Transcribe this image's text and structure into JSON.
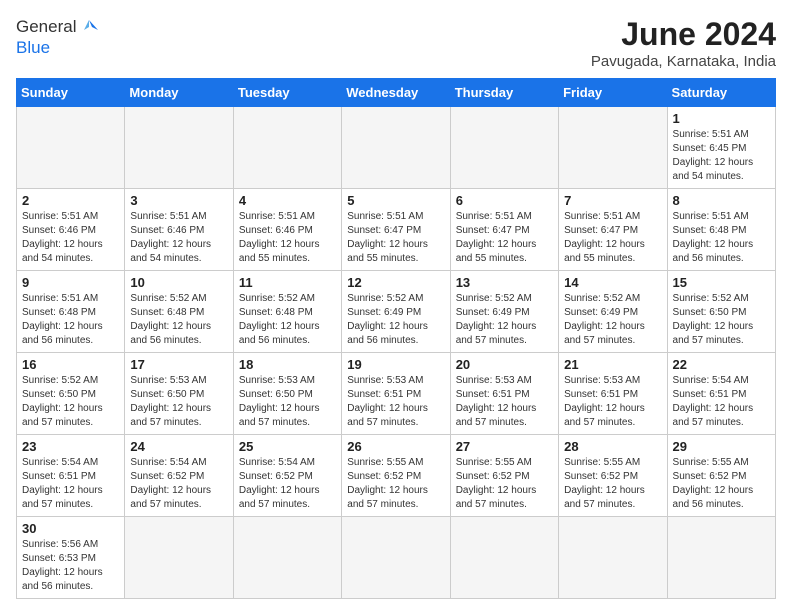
{
  "header": {
    "logo_general": "General",
    "logo_blue": "Blue",
    "month_title": "June 2024",
    "subtitle": "Pavugada, Karnataka, India"
  },
  "weekdays": [
    "Sunday",
    "Monday",
    "Tuesday",
    "Wednesday",
    "Thursday",
    "Friday",
    "Saturday"
  ],
  "weeks": [
    [
      {
        "day": "",
        "content": ""
      },
      {
        "day": "",
        "content": ""
      },
      {
        "day": "",
        "content": ""
      },
      {
        "day": "",
        "content": ""
      },
      {
        "day": "",
        "content": ""
      },
      {
        "day": "",
        "content": ""
      },
      {
        "day": "1",
        "content": "Sunrise: 5:51 AM\nSunset: 6:45 PM\nDaylight: 12 hours and 54 minutes."
      }
    ],
    [
      {
        "day": "2",
        "content": "Sunrise: 5:51 AM\nSunset: 6:46 PM\nDaylight: 12 hours and 54 minutes."
      },
      {
        "day": "3",
        "content": "Sunrise: 5:51 AM\nSunset: 6:46 PM\nDaylight: 12 hours and 54 minutes."
      },
      {
        "day": "4",
        "content": "Sunrise: 5:51 AM\nSunset: 6:46 PM\nDaylight: 12 hours and 55 minutes."
      },
      {
        "day": "5",
        "content": "Sunrise: 5:51 AM\nSunset: 6:47 PM\nDaylight: 12 hours and 55 minutes."
      },
      {
        "day": "6",
        "content": "Sunrise: 5:51 AM\nSunset: 6:47 PM\nDaylight: 12 hours and 55 minutes."
      },
      {
        "day": "7",
        "content": "Sunrise: 5:51 AM\nSunset: 6:47 PM\nDaylight: 12 hours and 55 minutes."
      },
      {
        "day": "8",
        "content": "Sunrise: 5:51 AM\nSunset: 6:48 PM\nDaylight: 12 hours and 56 minutes."
      }
    ],
    [
      {
        "day": "9",
        "content": "Sunrise: 5:51 AM\nSunset: 6:48 PM\nDaylight: 12 hours and 56 minutes."
      },
      {
        "day": "10",
        "content": "Sunrise: 5:52 AM\nSunset: 6:48 PM\nDaylight: 12 hours and 56 minutes."
      },
      {
        "day": "11",
        "content": "Sunrise: 5:52 AM\nSunset: 6:48 PM\nDaylight: 12 hours and 56 minutes."
      },
      {
        "day": "12",
        "content": "Sunrise: 5:52 AM\nSunset: 6:49 PM\nDaylight: 12 hours and 56 minutes."
      },
      {
        "day": "13",
        "content": "Sunrise: 5:52 AM\nSunset: 6:49 PM\nDaylight: 12 hours and 57 minutes."
      },
      {
        "day": "14",
        "content": "Sunrise: 5:52 AM\nSunset: 6:49 PM\nDaylight: 12 hours and 57 minutes."
      },
      {
        "day": "15",
        "content": "Sunrise: 5:52 AM\nSunset: 6:50 PM\nDaylight: 12 hours and 57 minutes."
      }
    ],
    [
      {
        "day": "16",
        "content": "Sunrise: 5:52 AM\nSunset: 6:50 PM\nDaylight: 12 hours and 57 minutes."
      },
      {
        "day": "17",
        "content": "Sunrise: 5:53 AM\nSunset: 6:50 PM\nDaylight: 12 hours and 57 minutes."
      },
      {
        "day": "18",
        "content": "Sunrise: 5:53 AM\nSunset: 6:50 PM\nDaylight: 12 hours and 57 minutes."
      },
      {
        "day": "19",
        "content": "Sunrise: 5:53 AM\nSunset: 6:51 PM\nDaylight: 12 hours and 57 minutes."
      },
      {
        "day": "20",
        "content": "Sunrise: 5:53 AM\nSunset: 6:51 PM\nDaylight: 12 hours and 57 minutes."
      },
      {
        "day": "21",
        "content": "Sunrise: 5:53 AM\nSunset: 6:51 PM\nDaylight: 12 hours and 57 minutes."
      },
      {
        "day": "22",
        "content": "Sunrise: 5:54 AM\nSunset: 6:51 PM\nDaylight: 12 hours and 57 minutes."
      }
    ],
    [
      {
        "day": "23",
        "content": "Sunrise: 5:54 AM\nSunset: 6:51 PM\nDaylight: 12 hours and 57 minutes."
      },
      {
        "day": "24",
        "content": "Sunrise: 5:54 AM\nSunset: 6:52 PM\nDaylight: 12 hours and 57 minutes."
      },
      {
        "day": "25",
        "content": "Sunrise: 5:54 AM\nSunset: 6:52 PM\nDaylight: 12 hours and 57 minutes."
      },
      {
        "day": "26",
        "content": "Sunrise: 5:55 AM\nSunset: 6:52 PM\nDaylight: 12 hours and 57 minutes."
      },
      {
        "day": "27",
        "content": "Sunrise: 5:55 AM\nSunset: 6:52 PM\nDaylight: 12 hours and 57 minutes."
      },
      {
        "day": "28",
        "content": "Sunrise: 5:55 AM\nSunset: 6:52 PM\nDaylight: 12 hours and 57 minutes."
      },
      {
        "day": "29",
        "content": "Sunrise: 5:55 AM\nSunset: 6:52 PM\nDaylight: 12 hours and 56 minutes."
      }
    ],
    [
      {
        "day": "30",
        "content": "Sunrise: 5:56 AM\nSunset: 6:53 PM\nDaylight: 12 hours and 56 minutes."
      },
      {
        "day": "",
        "content": ""
      },
      {
        "day": "",
        "content": ""
      },
      {
        "day": "",
        "content": ""
      },
      {
        "day": "",
        "content": ""
      },
      {
        "day": "",
        "content": ""
      },
      {
        "day": "",
        "content": ""
      }
    ]
  ]
}
